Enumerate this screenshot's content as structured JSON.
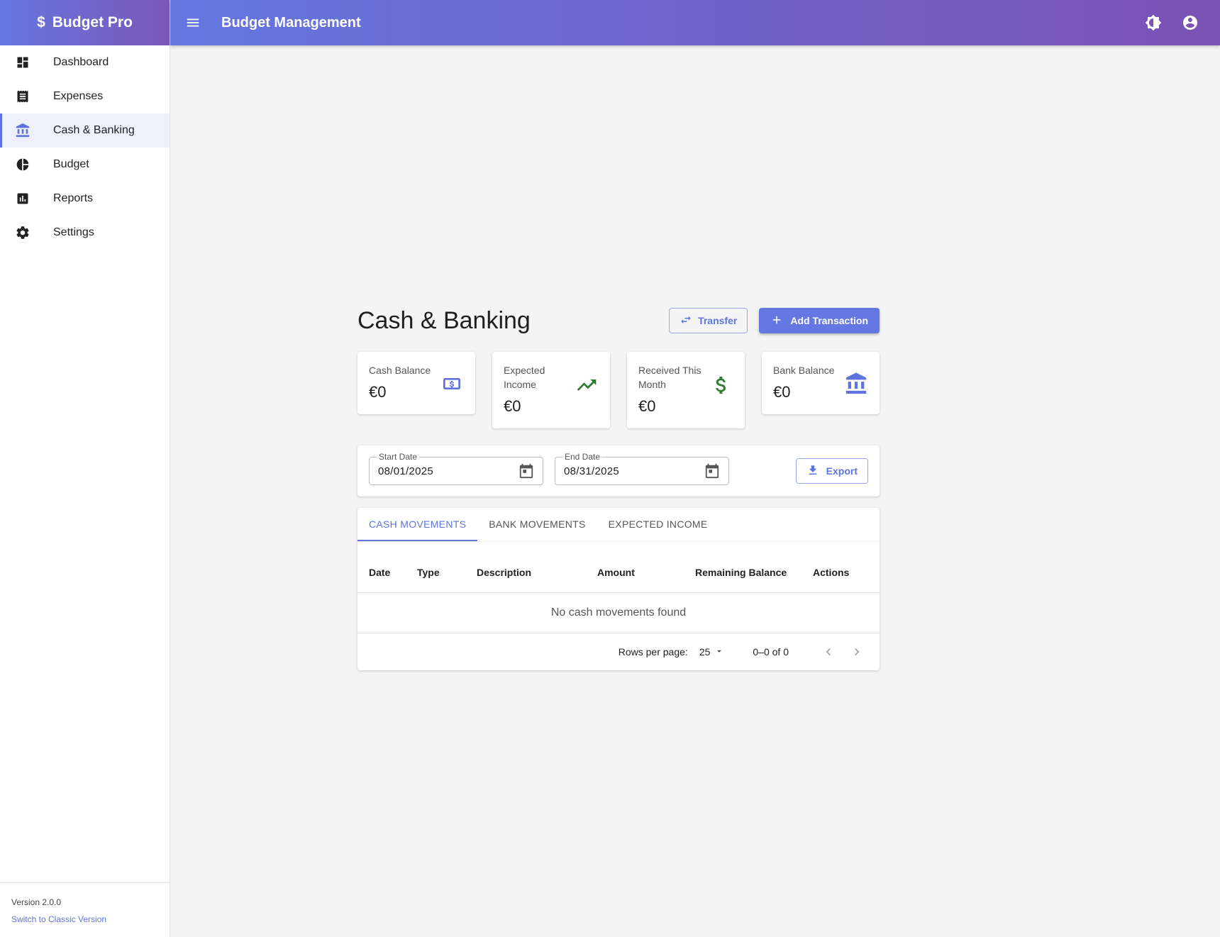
{
  "app": {
    "name": "Budget Pro",
    "brand_symbol": "$"
  },
  "header": {
    "title": "Budget Management"
  },
  "sidebar": {
    "items": [
      {
        "label": "Dashboard",
        "icon": "dashboard-icon"
      },
      {
        "label": "Expenses",
        "icon": "receipt-icon"
      },
      {
        "label": "Cash & Banking",
        "icon": "bank-icon",
        "active": true
      },
      {
        "label": "Budget",
        "icon": "pie-chart-icon"
      },
      {
        "label": "Reports",
        "icon": "bar-chart-icon"
      },
      {
        "label": "Settings",
        "icon": "gear-icon"
      }
    ],
    "version": "Version 2.0.0",
    "classic_link": "Switch to Classic Version"
  },
  "page": {
    "title": "Cash & Banking",
    "transfer_label": "Transfer",
    "add_label": "Add Transaction"
  },
  "cards": [
    {
      "label": "Cash Balance",
      "value": "€0",
      "icon": "money-icon",
      "color": "#5f73de"
    },
    {
      "label": "Expected Income",
      "value": "€0",
      "icon": "trending-up-icon",
      "color": "#2e7d32"
    },
    {
      "label": "Received This Month",
      "value": "€0",
      "icon": "dollar-icon",
      "color": "#2e7d32"
    },
    {
      "label": "Bank Balance",
      "value": "€0",
      "icon": "bank-icon",
      "color": "#5f73de"
    }
  ],
  "filters": {
    "start_label": "Start Date",
    "start_value": "08/01/2025",
    "end_label": "End Date",
    "end_value": "08/31/2025",
    "export_label": "Export"
  },
  "tabs": [
    "CASH MOVEMENTS",
    "BANK MOVEMENTS",
    "EXPECTED INCOME"
  ],
  "table": {
    "columns": [
      "Date",
      "Type",
      "Description",
      "Amount",
      "Remaining Balance",
      "Actions"
    ],
    "empty_message": "No cash movements found"
  },
  "pagination": {
    "rows_label": "Rows per page:",
    "rows_value": "25",
    "range": "0–0 of 0"
  },
  "colors": {
    "accent": "#5f73de",
    "header_start": "#6576e0",
    "header_end": "#7a52b3",
    "positive": "#2e7d32"
  }
}
